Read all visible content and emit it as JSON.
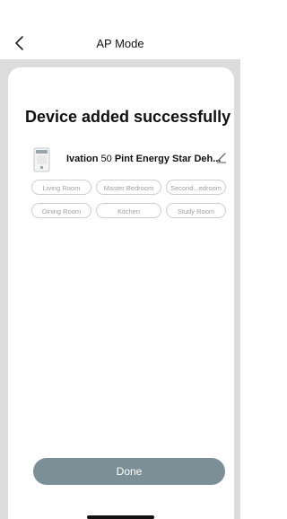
{
  "header": {
    "title": "AP Mode",
    "back_icon": "chevron-left-icon"
  },
  "main": {
    "headline": "Device added successfully",
    "device": {
      "brand": "Ivation",
      "name_rest": " 50 ",
      "name_bold": "Pint Energy Star Deh...",
      "thumbnail_icon": "dehumidifier-icon",
      "edit_icon": "pencil-icon"
    },
    "rooms": [
      {
        "label": "Living Room"
      },
      {
        "label": "Master Bedroom"
      },
      {
        "label": "Second...edroom"
      },
      {
        "label": "Dining Room"
      },
      {
        "label": "Kitchen"
      },
      {
        "label": "Study Room"
      }
    ],
    "done_label": "Done"
  },
  "colors": {
    "done_button": "#7b8f96",
    "backdrop": "#dcdcdc",
    "chip_border": "#cfcfcf",
    "chip_text": "#a0a0a0"
  }
}
